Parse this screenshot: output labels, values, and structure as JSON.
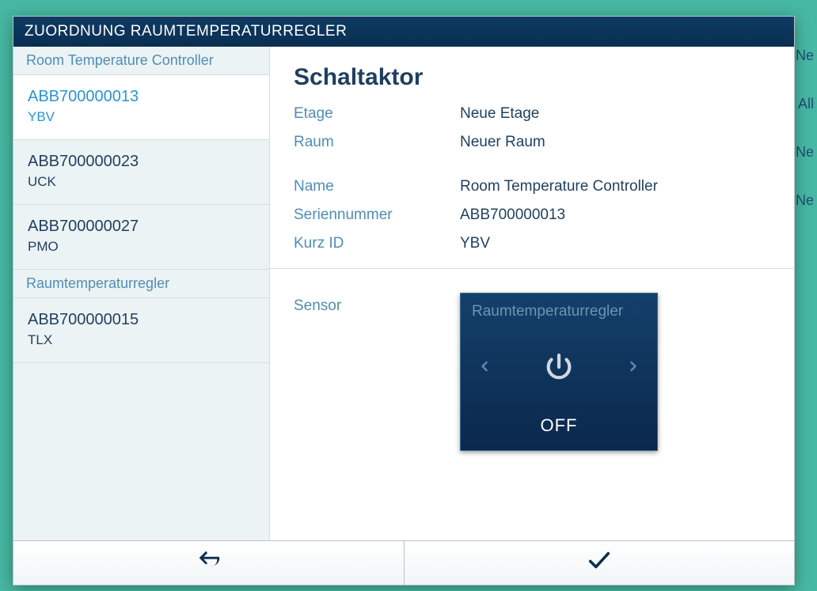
{
  "dialog_title": "ZUORDNUNG RAUMTEMPERATURREGLER",
  "background_hints": [
    "Ne",
    "All",
    "Ne",
    "Ne"
  ],
  "sidebar": {
    "sections": [
      {
        "header": "Room Temperature Controller",
        "items": [
          {
            "serial": "ABB700000013",
            "short": "YBV",
            "active": true
          },
          {
            "serial": "ABB700000023",
            "short": "UCK",
            "active": false
          },
          {
            "serial": "ABB700000027",
            "short": "PMO",
            "active": false
          }
        ]
      },
      {
        "header": "Raumtemperaturregler",
        "items": [
          {
            "serial": "ABB700000015",
            "short": "TLX",
            "active": false
          }
        ]
      }
    ]
  },
  "detail": {
    "title": "Schaltaktor",
    "labels": {
      "etage": "Etage",
      "raum": "Raum",
      "name": "Name",
      "seriennummer": "Seriennummer",
      "kurz_id": "Kurz ID",
      "sensor": "Sensor"
    },
    "values": {
      "etage": "Neue Etage",
      "raum": "Neuer Raum",
      "name": "Room Temperature Controller",
      "seriennummer": "ABB700000013",
      "kurz_id": "YBV"
    }
  },
  "sensor_tile": {
    "title": "Raumtemperaturregler",
    "state": "OFF"
  }
}
